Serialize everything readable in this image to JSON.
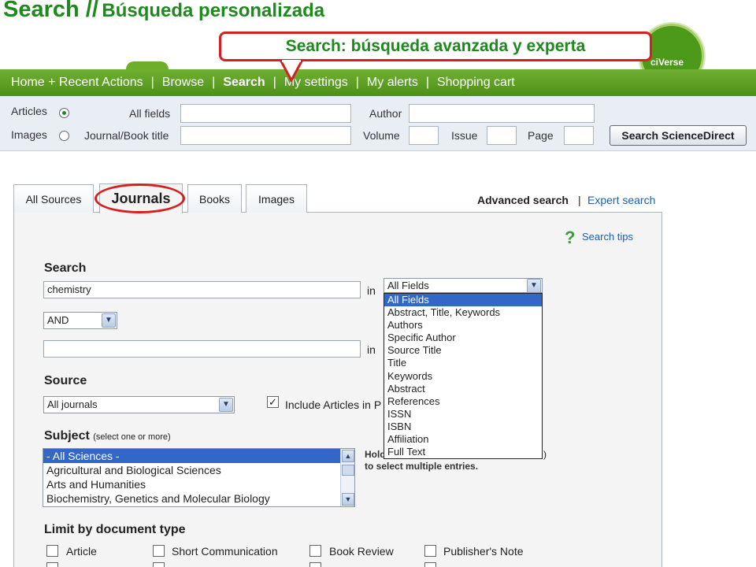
{
  "slide": {
    "title_main": "Search //",
    "title_sub": "Búsqueda personalizada",
    "callout": "Search: búsqueda avanzada y experta",
    "logo_text": "ciVerse"
  },
  "nav": {
    "items": [
      "Home + Recent Actions",
      "Browse",
      "Search",
      "My settings",
      "My alerts",
      "Shopping cart"
    ],
    "separator": "|",
    "active": "Search"
  },
  "quick_search": {
    "articles_label": "Articles",
    "images_label": "Images",
    "selected": "Articles",
    "all_fields_label": "All fields",
    "journal_label": "Journal/Book title",
    "author_label": "Author",
    "volume_label": "Volume",
    "issue_label": "Issue",
    "page_label": "Page",
    "button": "Search ScienceDirect"
  },
  "tabs": {
    "items": [
      "All Sources",
      "Journals",
      "Books",
      "Images"
    ],
    "active": "Journals"
  },
  "search_mode": {
    "advanced": "Advanced search",
    "separator": "|",
    "expert": "Expert search"
  },
  "form": {
    "search_tips": "Search tips",
    "search_label": "Search",
    "term1": "chemistry",
    "in_label": "in",
    "field_dropdown": {
      "selected": "All Fields",
      "options": [
        "All Fields",
        "Abstract, Title, Keywords",
        "Authors",
        "Specific Author",
        "Source Title",
        "Title",
        "Keywords",
        "Abstract",
        "References",
        "ISSN",
        "ISBN",
        "Affiliation",
        "Full Text"
      ]
    },
    "operator": "AND",
    "term2": "",
    "source_label": "Source",
    "source_value": "All journals",
    "include_articles": "Include Articles in P",
    "include_checked": true,
    "subject_label": "Subject",
    "subject_hint": "(select one or more)",
    "subjects": [
      "- All Sciences -",
      "Agricultural and Biological Sciences",
      "Arts and Humanities",
      "Biochemistry, Genetics and Molecular Biology"
    ],
    "selected_subject": "- All Sciences -",
    "hold_note_line1": "Hold",
    "hold_note_line2": "to select multiple entries.",
    "hold_note_tail": ")",
    "doc_type_label": "Limit by document type",
    "doc_types_row1": [
      "Article",
      "Short Communication",
      "Book Review",
      "Publisher's Note"
    ]
  }
}
